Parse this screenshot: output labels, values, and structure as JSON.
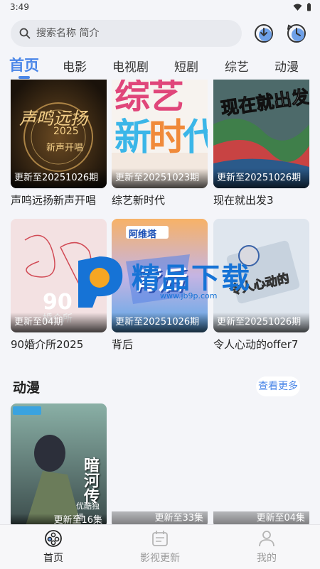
{
  "status_bar": {
    "time": "3:49"
  },
  "search": {
    "placeholder": "搜索名称 简介"
  },
  "tabs": [
    {
      "label": "首页",
      "active": true
    },
    {
      "label": "电影"
    },
    {
      "label": "电视剧"
    },
    {
      "label": "短剧"
    },
    {
      "label": "综艺"
    },
    {
      "label": "动漫"
    }
  ],
  "variety_cards": [
    {
      "title": "声鸣远扬新声开唱",
      "badge": "更新至20251026期",
      "poster_text": "声鸣远扬 2025 新声开唱"
    },
    {
      "title": "综艺新时代",
      "badge": "更新至20251023期",
      "poster_text": "综艺 新时代"
    },
    {
      "title": "现在就出发3",
      "badge": "更新至20251026期",
      "poster_text": "现在就出发"
    },
    {
      "title": "90婚介所2025",
      "badge": "更新至04期",
      "poster_text": "90 婚介所"
    },
    {
      "title": "背后",
      "badge": "更新至20251026期",
      "poster_text": "阿维塔 背后"
    },
    {
      "title": "令人心动的offer7",
      "badge": "更新至20251026期",
      "poster_text": "令人心动的"
    }
  ],
  "anime_section": {
    "title": "动漫",
    "more_label": "查看更多",
    "cards": [
      {
        "badge": "更新至16集",
        "poster_text": "暗河传",
        "tag": "优酷独播"
      },
      {
        "badge": "更新至33集"
      },
      {
        "badge": "更新至04集"
      }
    ]
  },
  "watermark": {
    "text": "精品下载",
    "url": "www.jb9p.com"
  },
  "bottom_nav": [
    {
      "label": "首页",
      "active": true
    },
    {
      "label": "影视更新"
    },
    {
      "label": "我的"
    }
  ],
  "colors": {
    "accent": "#4a86e8",
    "background": "#f4f5f9"
  }
}
